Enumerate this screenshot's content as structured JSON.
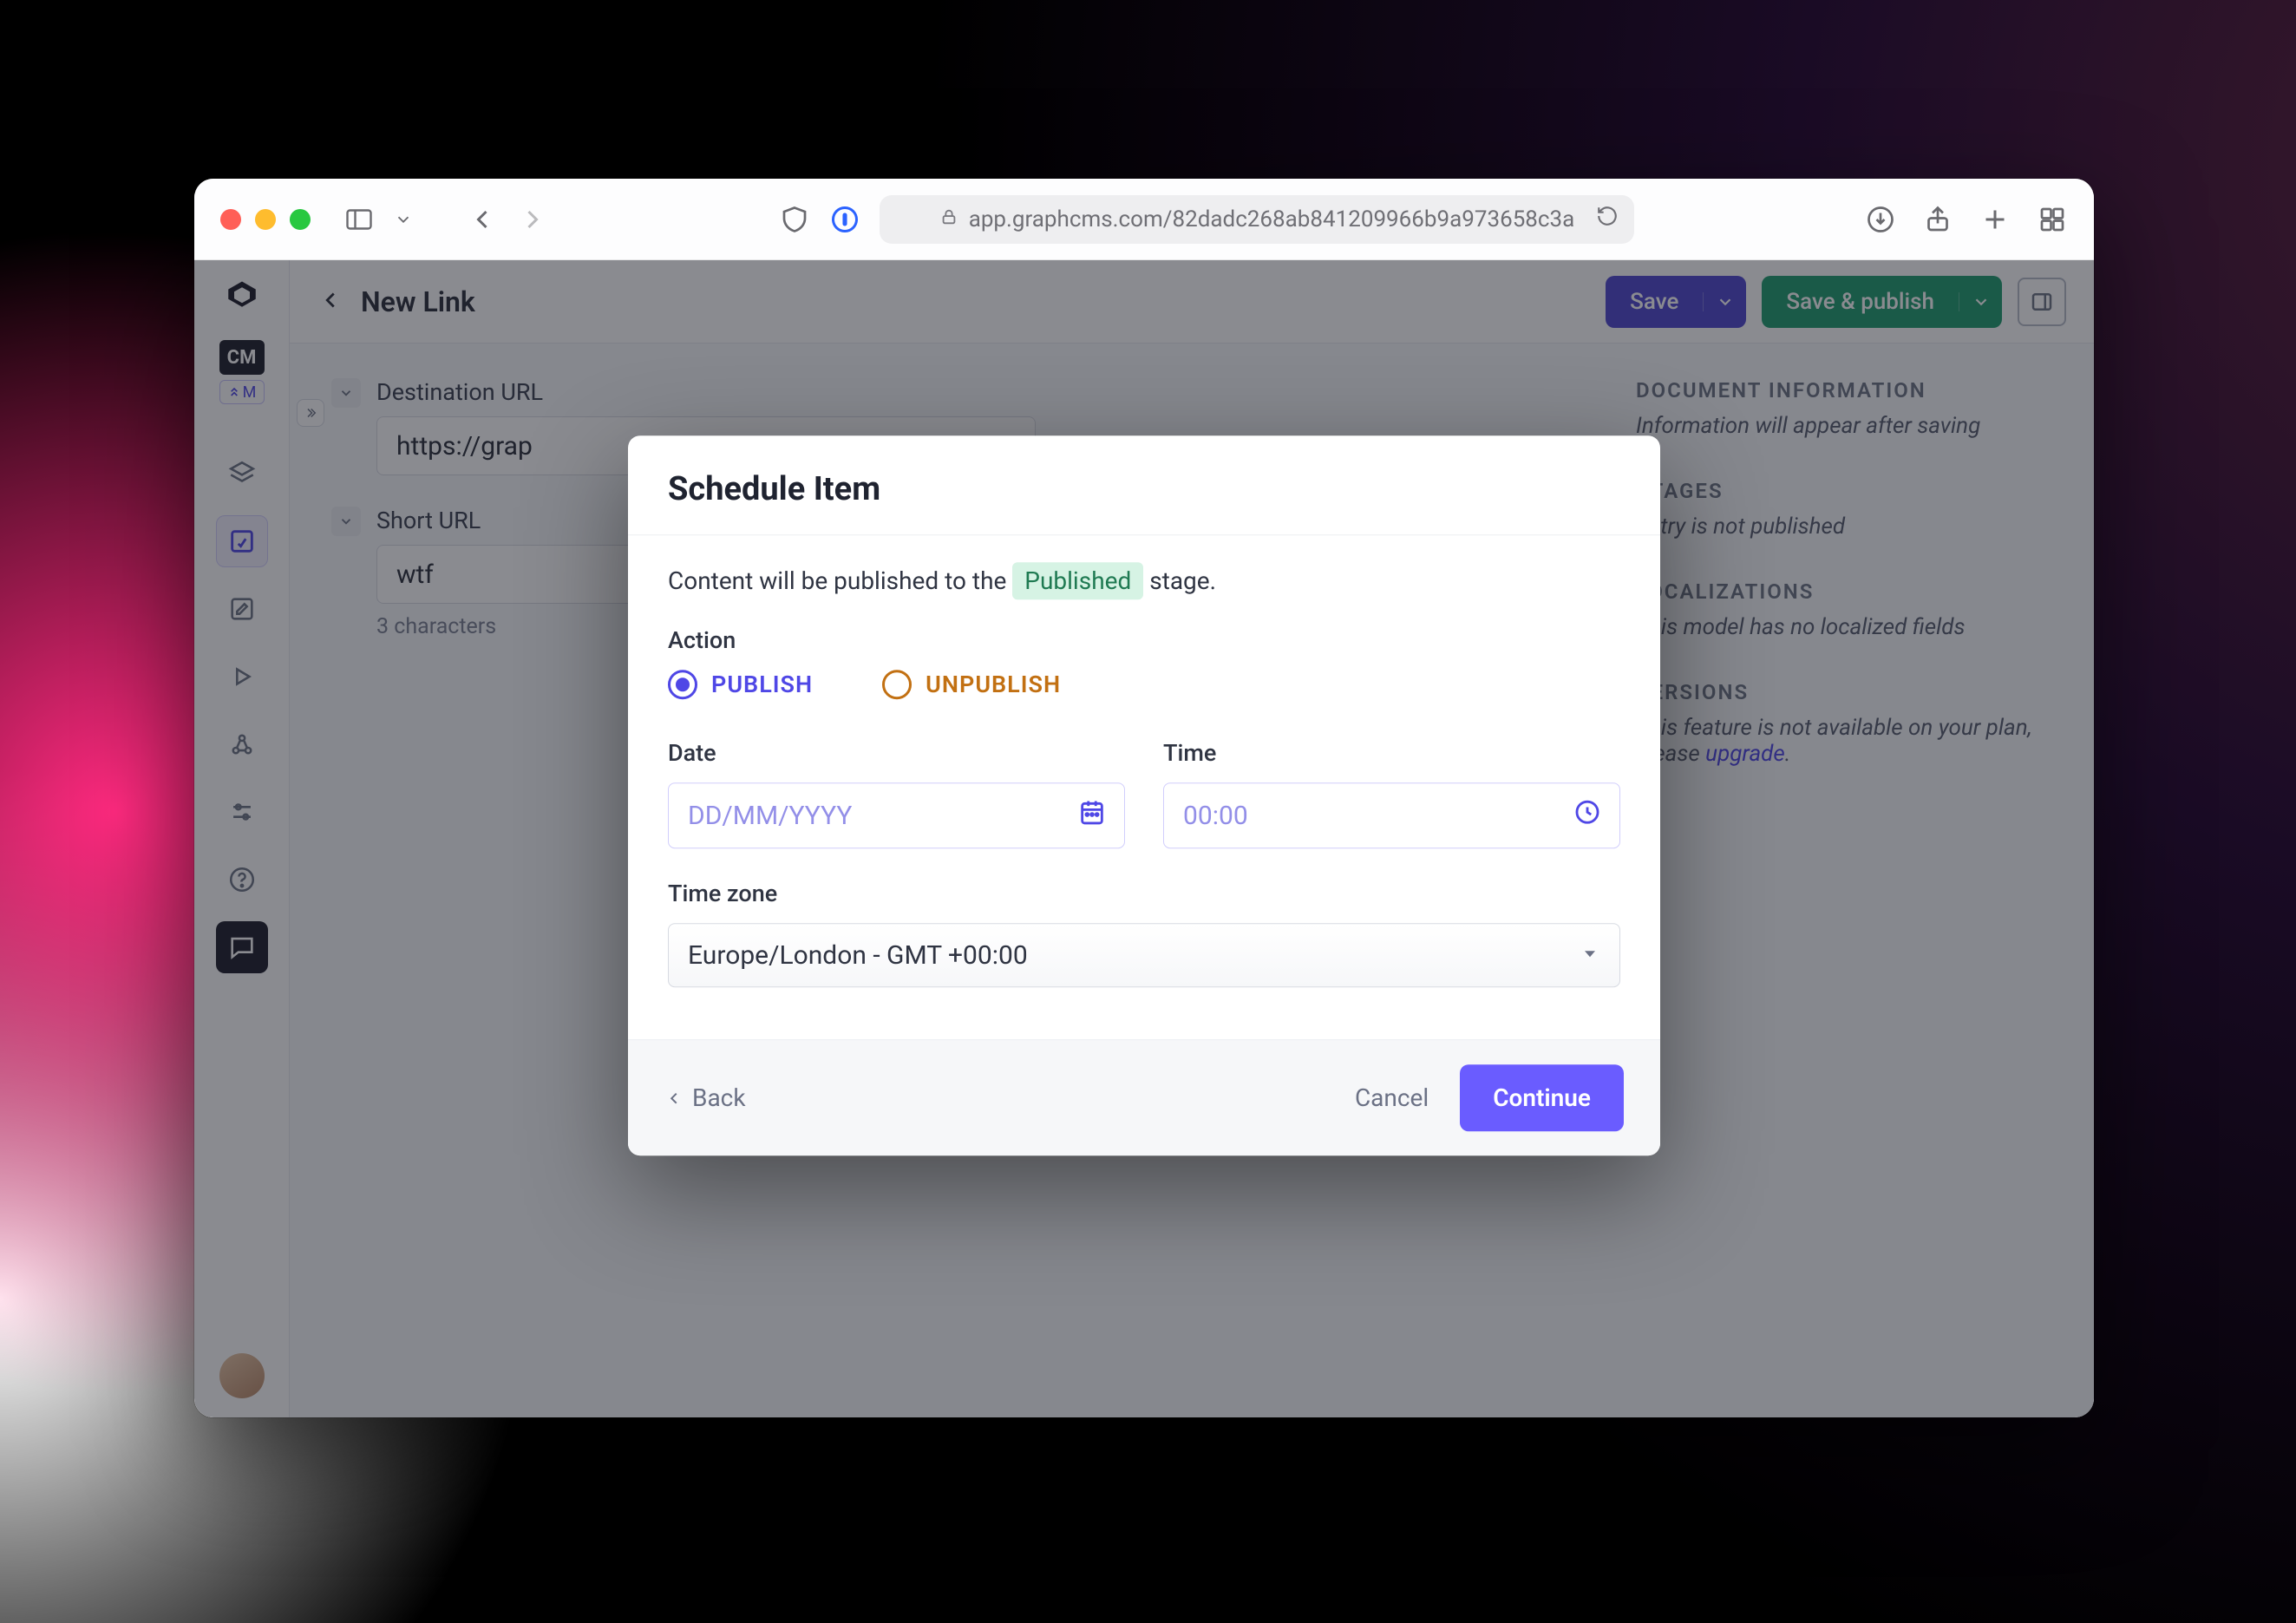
{
  "browser": {
    "url": "app.graphcms.com/82dadc268ab841209966b9a973658c3a"
  },
  "header": {
    "title": "New Link",
    "save": "Save",
    "save_publish": "Save & publish"
  },
  "leftrail": {
    "cm": "CM",
    "cm_sub": "M"
  },
  "form": {
    "dest_label": "Destination URL",
    "dest_value": "https://grap",
    "short_label": "Short URL",
    "short_value": "wtf",
    "short_help": "3 characters"
  },
  "sidebar": {
    "doc_title": "DOCUMENT INFORMATION",
    "doc_text": "Information will appear after saving",
    "stages_title": "STAGES",
    "stages_text": "Entry is not published",
    "loc_title": "LOCALIZATIONS",
    "loc_text": "This model has no localized fields",
    "ver_title": "VERSIONS",
    "ver_text": "This feature is not available on your plan, please ",
    "ver_link": "upgrade"
  },
  "modal": {
    "title": "Schedule Item",
    "sentence_a": "Content will be published to the ",
    "stage": "Published",
    "sentence_b": " stage.",
    "action_label": "Action",
    "publish": "PUBLISH",
    "unpublish": "UNPUBLISH",
    "date_label": "Date",
    "date_placeholder": "DD/MM/YYYY",
    "time_label": "Time",
    "time_placeholder": "00:00",
    "tz_label": "Time zone",
    "tz_value": "Europe/London - GMT +00:00",
    "back": "Back",
    "cancel": "Cancel",
    "continue": "Continue"
  }
}
